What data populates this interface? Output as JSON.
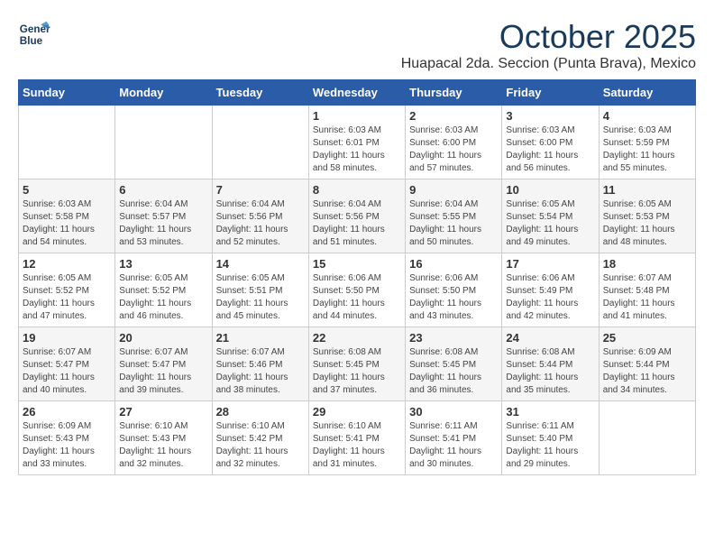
{
  "logo": {
    "line1": "General",
    "line2": "Blue"
  },
  "title": "October 2025",
  "subtitle": "Huapacal 2da. Seccion (Punta Brava), Mexico",
  "days_of_week": [
    "Sunday",
    "Monday",
    "Tuesday",
    "Wednesday",
    "Thursday",
    "Friday",
    "Saturday"
  ],
  "weeks": [
    [
      {
        "day": "",
        "info": ""
      },
      {
        "day": "",
        "info": ""
      },
      {
        "day": "",
        "info": ""
      },
      {
        "day": "1",
        "info": "Sunrise: 6:03 AM\nSunset: 6:01 PM\nDaylight: 11 hours and 58 minutes."
      },
      {
        "day": "2",
        "info": "Sunrise: 6:03 AM\nSunset: 6:00 PM\nDaylight: 11 hours and 57 minutes."
      },
      {
        "day": "3",
        "info": "Sunrise: 6:03 AM\nSunset: 6:00 PM\nDaylight: 11 hours and 56 minutes."
      },
      {
        "day": "4",
        "info": "Sunrise: 6:03 AM\nSunset: 5:59 PM\nDaylight: 11 hours and 55 minutes."
      }
    ],
    [
      {
        "day": "5",
        "info": "Sunrise: 6:03 AM\nSunset: 5:58 PM\nDaylight: 11 hours and 54 minutes."
      },
      {
        "day": "6",
        "info": "Sunrise: 6:04 AM\nSunset: 5:57 PM\nDaylight: 11 hours and 53 minutes."
      },
      {
        "day": "7",
        "info": "Sunrise: 6:04 AM\nSunset: 5:56 PM\nDaylight: 11 hours and 52 minutes."
      },
      {
        "day": "8",
        "info": "Sunrise: 6:04 AM\nSunset: 5:56 PM\nDaylight: 11 hours and 51 minutes."
      },
      {
        "day": "9",
        "info": "Sunrise: 6:04 AM\nSunset: 5:55 PM\nDaylight: 11 hours and 50 minutes."
      },
      {
        "day": "10",
        "info": "Sunrise: 6:05 AM\nSunset: 5:54 PM\nDaylight: 11 hours and 49 minutes."
      },
      {
        "day": "11",
        "info": "Sunrise: 6:05 AM\nSunset: 5:53 PM\nDaylight: 11 hours and 48 minutes."
      }
    ],
    [
      {
        "day": "12",
        "info": "Sunrise: 6:05 AM\nSunset: 5:52 PM\nDaylight: 11 hours and 47 minutes."
      },
      {
        "day": "13",
        "info": "Sunrise: 6:05 AM\nSunset: 5:52 PM\nDaylight: 11 hours and 46 minutes."
      },
      {
        "day": "14",
        "info": "Sunrise: 6:05 AM\nSunset: 5:51 PM\nDaylight: 11 hours and 45 minutes."
      },
      {
        "day": "15",
        "info": "Sunrise: 6:06 AM\nSunset: 5:50 PM\nDaylight: 11 hours and 44 minutes."
      },
      {
        "day": "16",
        "info": "Sunrise: 6:06 AM\nSunset: 5:50 PM\nDaylight: 11 hours and 43 minutes."
      },
      {
        "day": "17",
        "info": "Sunrise: 6:06 AM\nSunset: 5:49 PM\nDaylight: 11 hours and 42 minutes."
      },
      {
        "day": "18",
        "info": "Sunrise: 6:07 AM\nSunset: 5:48 PM\nDaylight: 11 hours and 41 minutes."
      }
    ],
    [
      {
        "day": "19",
        "info": "Sunrise: 6:07 AM\nSunset: 5:47 PM\nDaylight: 11 hours and 40 minutes."
      },
      {
        "day": "20",
        "info": "Sunrise: 6:07 AM\nSunset: 5:47 PM\nDaylight: 11 hours and 39 minutes."
      },
      {
        "day": "21",
        "info": "Sunrise: 6:07 AM\nSunset: 5:46 PM\nDaylight: 11 hours and 38 minutes."
      },
      {
        "day": "22",
        "info": "Sunrise: 6:08 AM\nSunset: 5:45 PM\nDaylight: 11 hours and 37 minutes."
      },
      {
        "day": "23",
        "info": "Sunrise: 6:08 AM\nSunset: 5:45 PM\nDaylight: 11 hours and 36 minutes."
      },
      {
        "day": "24",
        "info": "Sunrise: 6:08 AM\nSunset: 5:44 PM\nDaylight: 11 hours and 35 minutes."
      },
      {
        "day": "25",
        "info": "Sunrise: 6:09 AM\nSunset: 5:44 PM\nDaylight: 11 hours and 34 minutes."
      }
    ],
    [
      {
        "day": "26",
        "info": "Sunrise: 6:09 AM\nSunset: 5:43 PM\nDaylight: 11 hours and 33 minutes."
      },
      {
        "day": "27",
        "info": "Sunrise: 6:10 AM\nSunset: 5:43 PM\nDaylight: 11 hours and 32 minutes."
      },
      {
        "day": "28",
        "info": "Sunrise: 6:10 AM\nSunset: 5:42 PM\nDaylight: 11 hours and 32 minutes."
      },
      {
        "day": "29",
        "info": "Sunrise: 6:10 AM\nSunset: 5:41 PM\nDaylight: 11 hours and 31 minutes."
      },
      {
        "day": "30",
        "info": "Sunrise: 6:11 AM\nSunset: 5:41 PM\nDaylight: 11 hours and 30 minutes."
      },
      {
        "day": "31",
        "info": "Sunrise: 6:11 AM\nSunset: 5:40 PM\nDaylight: 11 hours and 29 minutes."
      },
      {
        "day": "",
        "info": ""
      }
    ]
  ]
}
